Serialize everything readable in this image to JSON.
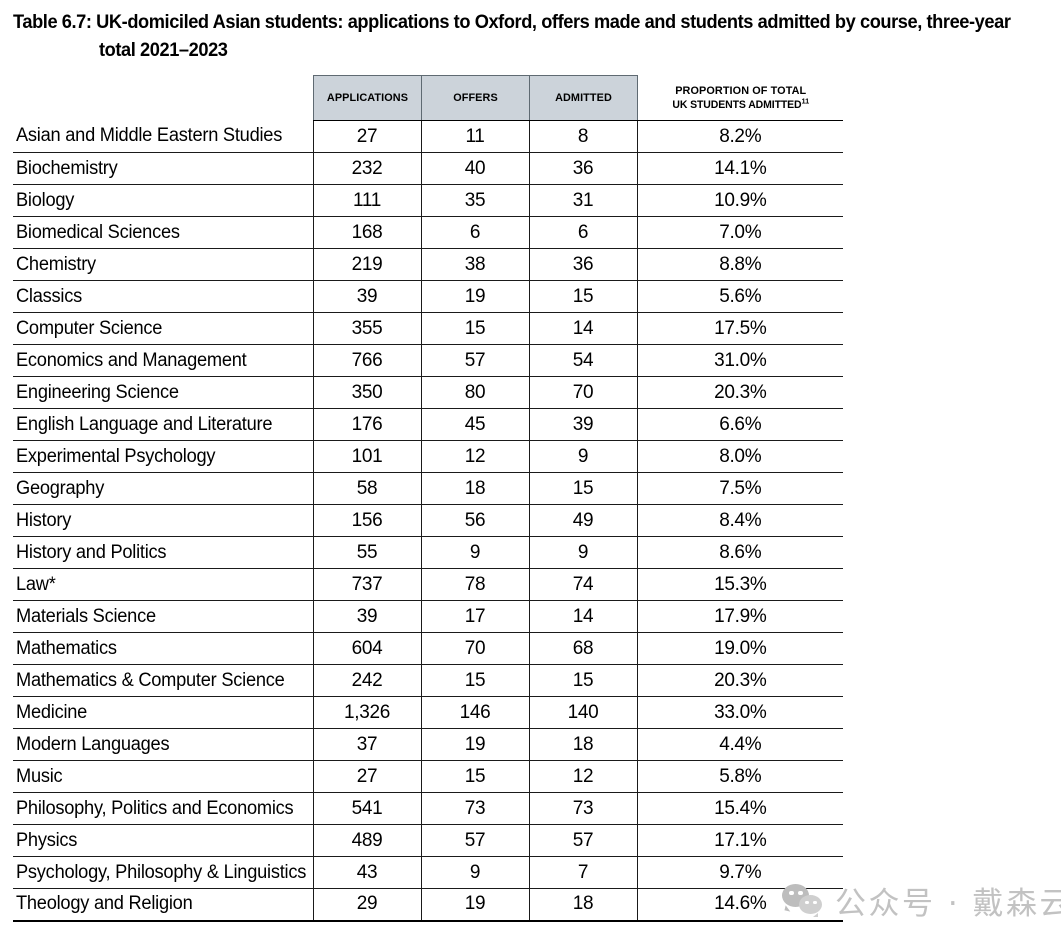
{
  "title": {
    "line1": "Table 6.7: UK-domiciled Asian students: applications to Oxford, offers made and students admitted by course, three-year",
    "line2": "total 2021–2023"
  },
  "table": {
    "columns": {
      "course": "",
      "applications": "APPLICATIONS",
      "offers": "OFFERS",
      "admitted": "ADMITTED",
      "proportion_line1": "PROPORTION OF TOTAL",
      "proportion_line2": "UK STUDENTS ADMITTED",
      "proportion_footnote": "11"
    },
    "rows": [
      {
        "course": "Asian and Middle Eastern Studies",
        "applications": "27",
        "offers": "11",
        "admitted": "8",
        "proportion": "8.2%"
      },
      {
        "course": "Biochemistry",
        "applications": "232",
        "offers": "40",
        "admitted": "36",
        "proportion": "14.1%"
      },
      {
        "course": "Biology",
        "applications": "111",
        "offers": "35",
        "admitted": "31",
        "proportion": "10.9%"
      },
      {
        "course": "Biomedical Sciences",
        "applications": "168",
        "offers": "6",
        "admitted": "6",
        "proportion": "7.0%"
      },
      {
        "course": "Chemistry",
        "applications": "219",
        "offers": "38",
        "admitted": "36",
        "proportion": "8.8%"
      },
      {
        "course": "Classics",
        "applications": "39",
        "offers": "19",
        "admitted": "15",
        "proportion": "5.6%"
      },
      {
        "course": "Computer Science",
        "applications": "355",
        "offers": "15",
        "admitted": "14",
        "proportion": "17.5%"
      },
      {
        "course": "Economics and Management",
        "applications": "766",
        "offers": "57",
        "admitted": "54",
        "proportion": "31.0%"
      },
      {
        "course": "Engineering Science",
        "applications": "350",
        "offers": "80",
        "admitted": "70",
        "proportion": "20.3%"
      },
      {
        "course": "English Language and Literature",
        "applications": "176",
        "offers": "45",
        "admitted": "39",
        "proportion": "6.6%"
      },
      {
        "course": "Experimental Psychology",
        "applications": "101",
        "offers": "12",
        "admitted": "9",
        "proportion": "8.0%"
      },
      {
        "course": "Geography",
        "applications": "58",
        "offers": "18",
        "admitted": "15",
        "proportion": "7.5%"
      },
      {
        "course": "History",
        "applications": "156",
        "offers": "56",
        "admitted": "49",
        "proportion": "8.4%"
      },
      {
        "course": "History and Politics",
        "applications": "55",
        "offers": "9",
        "admitted": "9",
        "proportion": "8.6%"
      },
      {
        "course": "Law*",
        "applications": "737",
        "offers": "78",
        "admitted": "74",
        "proportion": "15.3%"
      },
      {
        "course": "Materials Science",
        "applications": "39",
        "offers": "17",
        "admitted": "14",
        "proportion": "17.9%"
      },
      {
        "course": "Mathematics",
        "applications": "604",
        "offers": "70",
        "admitted": "68",
        "proportion": "19.0%"
      },
      {
        "course": "Mathematics & Computer Science",
        "applications": "242",
        "offers": "15",
        "admitted": "15",
        "proportion": "20.3%"
      },
      {
        "course": "Medicine",
        "applications": "1,326",
        "offers": "146",
        "admitted": "140",
        "proportion": "33.0%"
      },
      {
        "course": "Modern Languages",
        "applications": "37",
        "offers": "19",
        "admitted": "18",
        "proportion": "4.4%"
      },
      {
        "course": "Music",
        "applications": "27",
        "offers": "15",
        "admitted": "12",
        "proportion": "5.8%"
      },
      {
        "course": "Philosophy, Politics and Economics",
        "applications": "541",
        "offers": "73",
        "admitted": "73",
        "proportion": "15.4%"
      },
      {
        "course": "Physics",
        "applications": "489",
        "offers": "57",
        "admitted": "57",
        "proportion": "17.1%"
      },
      {
        "course": "Psychology, Philosophy & Linguistics",
        "applications": "43",
        "offers": "9",
        "admitted": "7",
        "proportion": "9.7%"
      },
      {
        "course": "Theology and Religion",
        "applications": "29",
        "offers": "19",
        "admitted": "18",
        "proportion": "14.6%"
      }
    ]
  },
  "watermark": {
    "icon": "wechat-icon",
    "text": "公众号 · 戴森云"
  },
  "colors": {
    "header_background": "#ccd3da",
    "border": "#1a1a1a",
    "watermark_gray": "#c2c2c2"
  }
}
